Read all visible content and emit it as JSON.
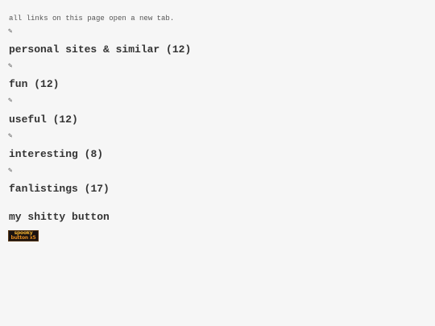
{
  "notice": "all links on this page open a new tab.",
  "icons": {
    "edit": "pencil-icon",
    "edit_glyph": "✎"
  },
  "sections": [
    {
      "label": "personal sites & similar",
      "count": "(12)"
    },
    {
      "label": "fun",
      "count": "(12)"
    },
    {
      "label": "useful",
      "count": "(12)"
    },
    {
      "label": "interesting",
      "count": "(8)"
    },
    {
      "label": "fanlistings",
      "count": "(17)"
    }
  ],
  "button_section": {
    "heading": "my shitty button",
    "badge_line1": "spooky",
    "badge_line2": "button x5"
  },
  "colors": {
    "background": "#f6f6f6",
    "text": "#333333",
    "badge_bg": "#1a1210",
    "badge_text": "#f0b030"
  }
}
